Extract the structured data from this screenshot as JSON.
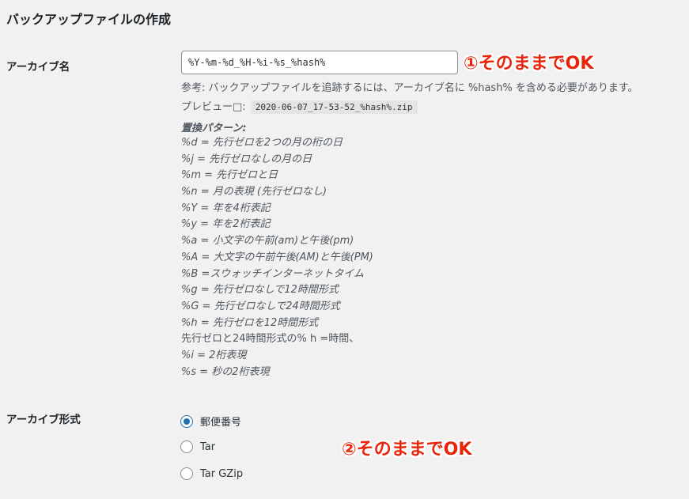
{
  "section_title": "バックアップファイルの作成",
  "archive_name": {
    "label": "アーカイブ名",
    "value": "%Y-%m-%d_%H-%i-%s_%hash%",
    "note": "①そのままでOK",
    "hint": "参考: バックアップファイルを追跡するには、アーカイブ名に %hash% を含める必要があります。",
    "preview_label": "プレビュー□:",
    "preview_value": "2020-06-07_17-53-52_%hash%.zip",
    "patterns_title": "置換パターン:",
    "patterns": [
      "%d = 先行ゼロを2つの月の桁の日",
      "%j = 先行ゼロなしの月の日",
      "%m = 先行ゼロと日",
      "%n = 月の表現 (先行ゼロなし)",
      "%Y = 年を4桁表記",
      "%y = 年を2桁表記",
      "%a = 小文字の午前(am)と午後(pm)",
      "%A = 大文字の午前午後(AM)と午後(PM)",
      "%B =スウォッチインターネットタイム",
      "%g = 先行ゼロなしで12時間形式",
      "%G = 先行ゼロなしで24時間形式",
      "%h = 先行ゼロを12時間形式",
      "先行ゼロと24時間形式の% h =時間、",
      "%i = 2桁表現",
      "%s = 秒の2桁表現"
    ]
  },
  "archive_format": {
    "label": "アーカイブ形式",
    "note": "②そのままでOK",
    "options": [
      {
        "label": "郵便番号",
        "checked": true
      },
      {
        "label": "Tar",
        "checked": false
      },
      {
        "label": "Tar GZip",
        "checked": false
      }
    ]
  },
  "colors": {
    "accent": "#2271b1",
    "annotation": "#e8240a",
    "background": "#f1f1f1"
  }
}
